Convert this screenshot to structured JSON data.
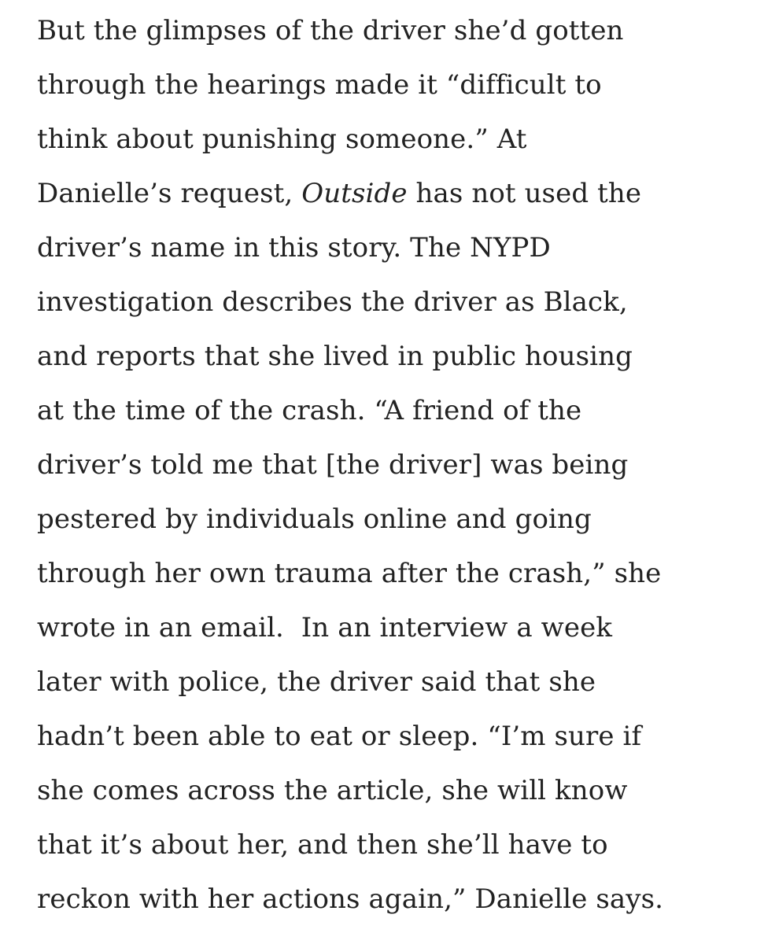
{
  "article": {
    "lines": [
      {
        "a": "But the glimpses of the driver she’d gotten"
      },
      {
        "a": "through the hearings made it “difficult to"
      },
      {
        "a": "think about punishing someone.” At"
      },
      {
        "a": "Danielle’s request, ",
        "em": "Outside",
        "b": " has not used the"
      },
      {
        "a": "driver’s name in this story. The NYPD"
      },
      {
        "a": "investigation describes the driver as Black,"
      },
      {
        "a": "and reports that she lived in public housing"
      },
      {
        "a": "at the time of the crash. “A friend of the"
      },
      {
        "a": "driver’s told me that [the driver] was being"
      },
      {
        "a": "pestered by individuals online and going"
      },
      {
        "a": "through her own trauma after the crash,” she"
      },
      {
        "a": "wrote in an email.  In an interview a week"
      },
      {
        "a": "later with police, the driver said that she"
      },
      {
        "a": "hadn’t been able to eat or sleep. “I’m sure if"
      },
      {
        "a": "she comes across the article, she will know"
      },
      {
        "a": "that it’s about her, and then she’ll have to"
      },
      {
        "a": "reckon with her actions again,” Danielle says."
      }
    ]
  }
}
